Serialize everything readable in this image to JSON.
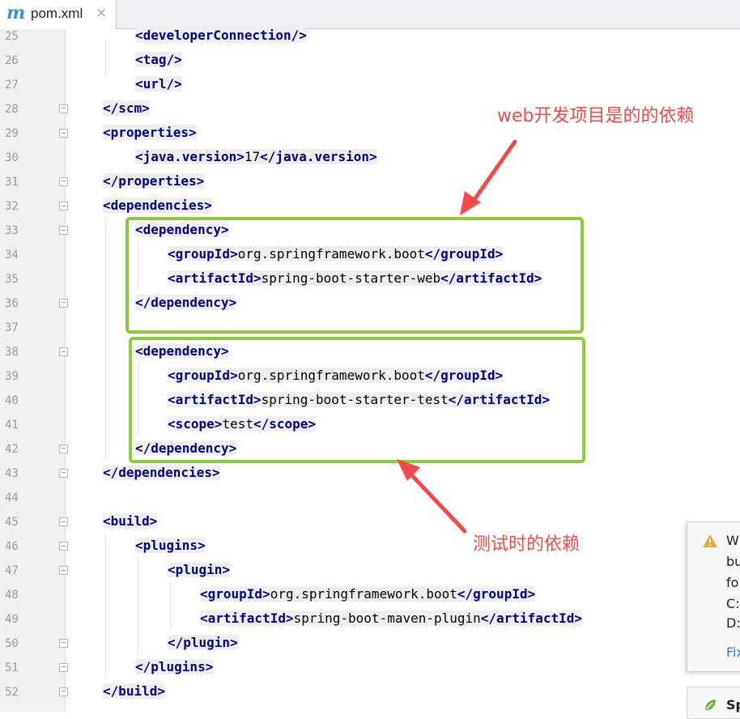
{
  "tab": {
    "icon": "maven-m-icon",
    "icon_glyph": "m",
    "label": "pom.xml",
    "close": "×"
  },
  "lines": [
    {
      "no": "25",
      "indent": 2,
      "parts": [
        [
          "t",
          "<developerConnection/>"
        ]
      ]
    },
    {
      "no": "26",
      "indent": 2,
      "parts": [
        [
          "t",
          "<tag/>"
        ]
      ]
    },
    {
      "no": "27",
      "indent": 2,
      "parts": [
        [
          "t",
          "<url/>"
        ]
      ]
    },
    {
      "no": "28",
      "indent": 1,
      "fold": "close",
      "parts": [
        [
          "t",
          "</scm>"
        ]
      ]
    },
    {
      "no": "29",
      "indent": 1,
      "fold": "open",
      "parts": [
        [
          "t",
          "<properties>"
        ]
      ]
    },
    {
      "no": "30",
      "indent": 2,
      "parts": [
        [
          "t",
          "<java.version>"
        ],
        [
          "x",
          "17"
        ],
        [
          "t",
          "</java.version>"
        ]
      ]
    },
    {
      "no": "31",
      "indent": 1,
      "fold": "close",
      "parts": [
        [
          "t",
          "</properties>"
        ]
      ]
    },
    {
      "no": "32",
      "indent": 1,
      "fold": "open",
      "parts": [
        [
          "t",
          "<dependencies>"
        ]
      ]
    },
    {
      "no": "33",
      "indent": 2,
      "fold": "open",
      "parts": [
        [
          "t",
          "<dependency>"
        ]
      ]
    },
    {
      "no": "34",
      "indent": 3,
      "parts": [
        [
          "t",
          "<groupId>"
        ],
        [
          "x",
          "org.springframework.boot"
        ],
        [
          "t",
          "</groupId>"
        ]
      ]
    },
    {
      "no": "35",
      "indent": 3,
      "parts": [
        [
          "t",
          "<artifactId>"
        ],
        [
          "x",
          "spring-boot-starter-web"
        ],
        [
          "t",
          "</artifactId>"
        ]
      ]
    },
    {
      "no": "36",
      "indent": 2,
      "fold": "close",
      "parts": [
        [
          "t",
          "</dependency>"
        ]
      ]
    },
    {
      "no": "37",
      "indent": 0,
      "parts": []
    },
    {
      "no": "38",
      "indent": 2,
      "fold": "open",
      "parts": [
        [
          "t",
          "<dependency>"
        ]
      ]
    },
    {
      "no": "39",
      "indent": 3,
      "parts": [
        [
          "t",
          "<groupId>"
        ],
        [
          "x",
          "org.springframework.boot"
        ],
        [
          "t",
          "</groupId>"
        ]
      ]
    },
    {
      "no": "40",
      "indent": 3,
      "parts": [
        [
          "t",
          "<artifactId>"
        ],
        [
          "x",
          "spring-boot-starter-test"
        ],
        [
          "t",
          "</artifactId>"
        ]
      ]
    },
    {
      "no": "41",
      "indent": 3,
      "parts": [
        [
          "t",
          "<scope>"
        ],
        [
          "x",
          "test"
        ],
        [
          "t",
          "</scope>"
        ]
      ]
    },
    {
      "no": "42",
      "indent": 2,
      "fold": "close",
      "parts": [
        [
          "t",
          "</dependency>"
        ]
      ]
    },
    {
      "no": "43",
      "indent": 1,
      "fold": "close",
      "parts": [
        [
          "t",
          "</dependencies>"
        ]
      ]
    },
    {
      "no": "44",
      "indent": 0,
      "parts": []
    },
    {
      "no": "45",
      "indent": 1,
      "fold": "open",
      "parts": [
        [
          "t",
          "<build>"
        ]
      ]
    },
    {
      "no": "46",
      "indent": 2,
      "fold": "open",
      "parts": [
        [
          "t",
          "<plugins>"
        ]
      ]
    },
    {
      "no": "47",
      "indent": 3,
      "fold": "open",
      "parts": [
        [
          "t",
          "<plugin>"
        ]
      ]
    },
    {
      "no": "48",
      "indent": 4,
      "parts": [
        [
          "t",
          "<groupId>"
        ],
        [
          "x",
          "org.springframework.boot"
        ],
        [
          "t",
          "</groupId>"
        ]
      ]
    },
    {
      "no": "49",
      "indent": 4,
      "parts": [
        [
          "t",
          "<artifactId>"
        ],
        [
          "x",
          "spring-boot-maven-plugin"
        ],
        [
          "t",
          "</artifactId>"
        ]
      ]
    },
    {
      "no": "50",
      "indent": 3,
      "fold": "close",
      "parts": [
        [
          "t",
          "</plugin>"
        ]
      ]
    },
    {
      "no": "51",
      "indent": 2,
      "fold": "close",
      "parts": [
        [
          "t",
          "</plugins>"
        ]
      ]
    },
    {
      "no": "52",
      "indent": 1,
      "fold": "close",
      "parts": [
        [
          "t",
          "</build>"
        ]
      ]
    }
  ],
  "annotations": {
    "web_label": "web开发项目是的的依赖",
    "test_label": "测试时的依赖",
    "color": "#ef4b4b",
    "box_color": "#8ccb3c"
  },
  "notification": {
    "icon": "warning-icon",
    "lines": [
      "W",
      "bu",
      "fo",
      "C:\\",
      "D:"
    ],
    "link": "Fix"
  },
  "notification2": {
    "icon": "spring-leaf-icon",
    "label": "Sp"
  }
}
